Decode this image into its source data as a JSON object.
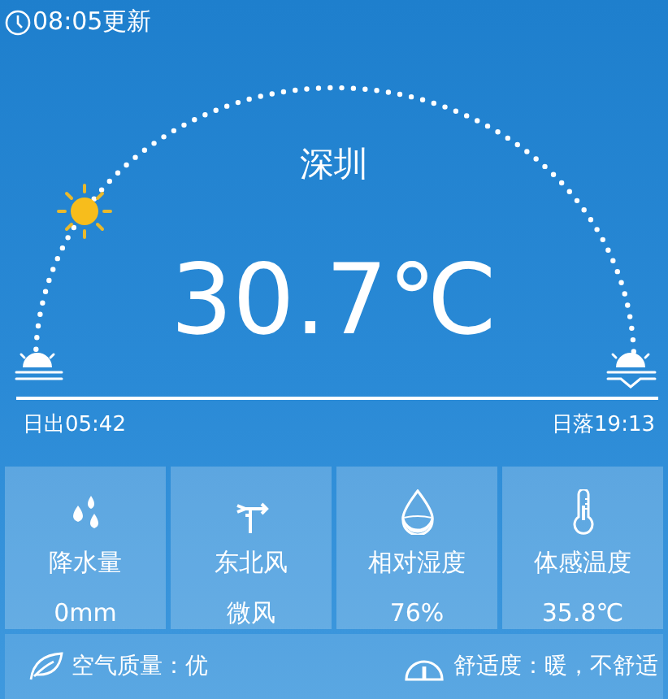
{
  "updated": "08:05更新",
  "city": "深圳",
  "temperature": "30.7℃",
  "sunrise": "日出05:42",
  "sunset": "日落19:13",
  "stats": [
    {
      "kind": "precipitation",
      "label": "降水量",
      "value": "0mm"
    },
    {
      "kind": "wind",
      "label": "东北风",
      "value": "微风"
    },
    {
      "kind": "humidity",
      "label": "相对湿度",
      "value": "76%"
    },
    {
      "kind": "feels",
      "label": "体感温度",
      "value": "35.8℃"
    }
  ],
  "air_quality": "空气质量：优",
  "comfort": "舒适度：暖，不舒适"
}
